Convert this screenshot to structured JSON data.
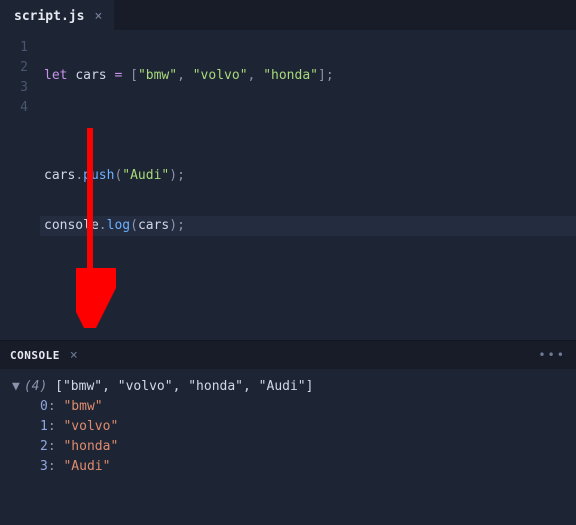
{
  "tab": {
    "title": "script.js",
    "close_glyph": "×"
  },
  "editor": {
    "lines": [
      {
        "n": "1"
      },
      {
        "n": "2"
      },
      {
        "n": "3"
      },
      {
        "n": "4"
      }
    ],
    "code": {
      "let": "let",
      "cars": "cars",
      "eq": "=",
      "lbrack": "[",
      "rbrack": "]",
      "comma": ",",
      "semi": ";",
      "dot": ".",
      "lparen": "(",
      "rparen": ")",
      "s_bmw": "\"bmw\"",
      "s_volvo": "\"volvo\"",
      "s_honda": "\"honda\"",
      "s_audi": "\"Audi\"",
      "push": "push",
      "console": "console",
      "log": "log"
    }
  },
  "panel": {
    "title": "CONSOLE",
    "close_glyph": "×",
    "more_glyph": "•••"
  },
  "console": {
    "caret": "▼",
    "len_label": "(4)",
    "summary_open": " [",
    "summary_close": "]",
    "summary_items": [
      "\"bmw\"",
      "\"volvo\"",
      "\"honda\"",
      "\"Audi\""
    ],
    "entries": [
      {
        "index": "0",
        "value": "\"bmw\""
      },
      {
        "index": "1",
        "value": "\"volvo\""
      },
      {
        "index": "2",
        "value": "\"honda\""
      },
      {
        "index": "3",
        "value": "\"Audi\""
      }
    ],
    "colon": ":"
  }
}
